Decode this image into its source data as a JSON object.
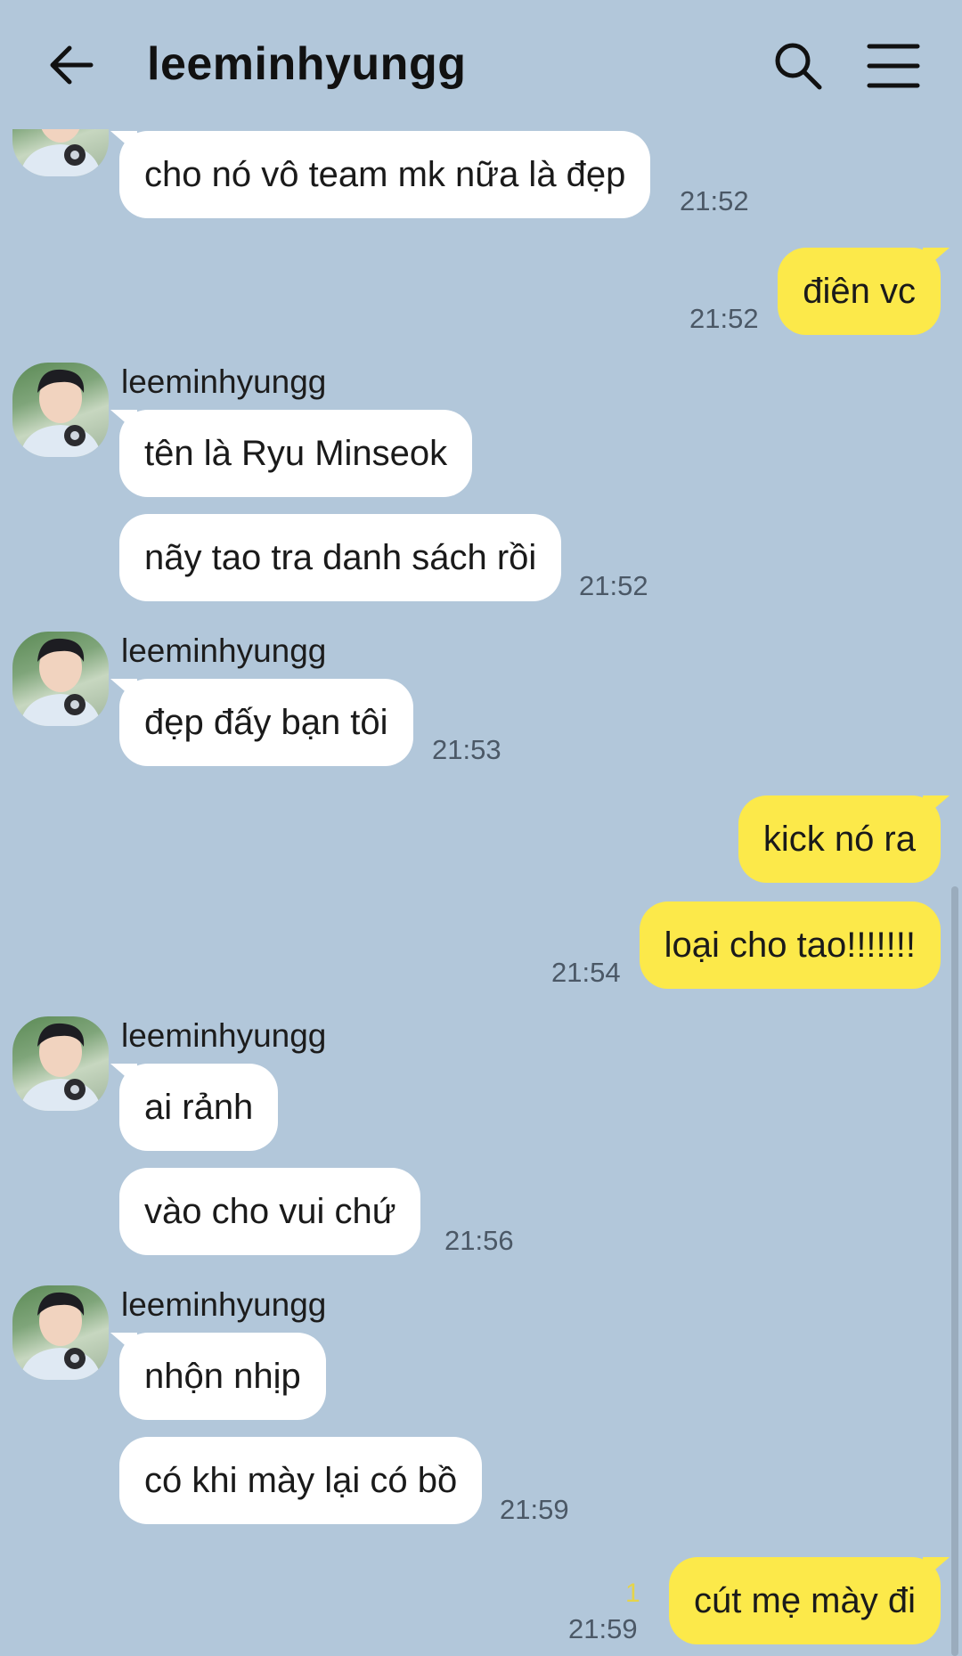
{
  "header": {
    "title": "leeminhyungg",
    "back_icon": "arrow-left-icon",
    "search_icon": "search-icon",
    "menu_icon": "hamburger-menu-icon"
  },
  "colors": {
    "background": "#b2c7da",
    "incoming_bubble": "#ffffff",
    "outgoing_bubble": "#fce94a",
    "unread_count": "#e5d44a"
  },
  "messages": [
    {
      "direction": "in",
      "text": "cho nó vô team mk nữa là đẹp",
      "time": "21:52"
    },
    {
      "direction": "out",
      "text": "điên vc",
      "time": "21:52"
    },
    {
      "direction": "in",
      "sender": "leeminhyungg",
      "text": "tên là Ryu Minseok"
    },
    {
      "direction": "in",
      "text": "nãy tao tra danh sách rồi",
      "time": "21:52"
    },
    {
      "direction": "in",
      "sender": "leeminhyungg",
      "text": "đẹp đấy bạn tôi",
      "time": "21:53"
    },
    {
      "direction": "out",
      "text": "kick nó ra"
    },
    {
      "direction": "out",
      "text": "loại cho tao!!!!!!!",
      "time": "21:54"
    },
    {
      "direction": "in",
      "sender": "leeminhyungg",
      "text": "ai rảnh"
    },
    {
      "direction": "in",
      "text": "vào cho vui chứ",
      "time": "21:56"
    },
    {
      "direction": "in",
      "sender": "leeminhyungg",
      "text": "nhộn nhịp"
    },
    {
      "direction": "in",
      "text": "có khi mày lại có bồ",
      "time": "21:59"
    },
    {
      "direction": "out",
      "text": "cút mẹ mày đi",
      "time": "21:59",
      "unread": "1"
    }
  ]
}
